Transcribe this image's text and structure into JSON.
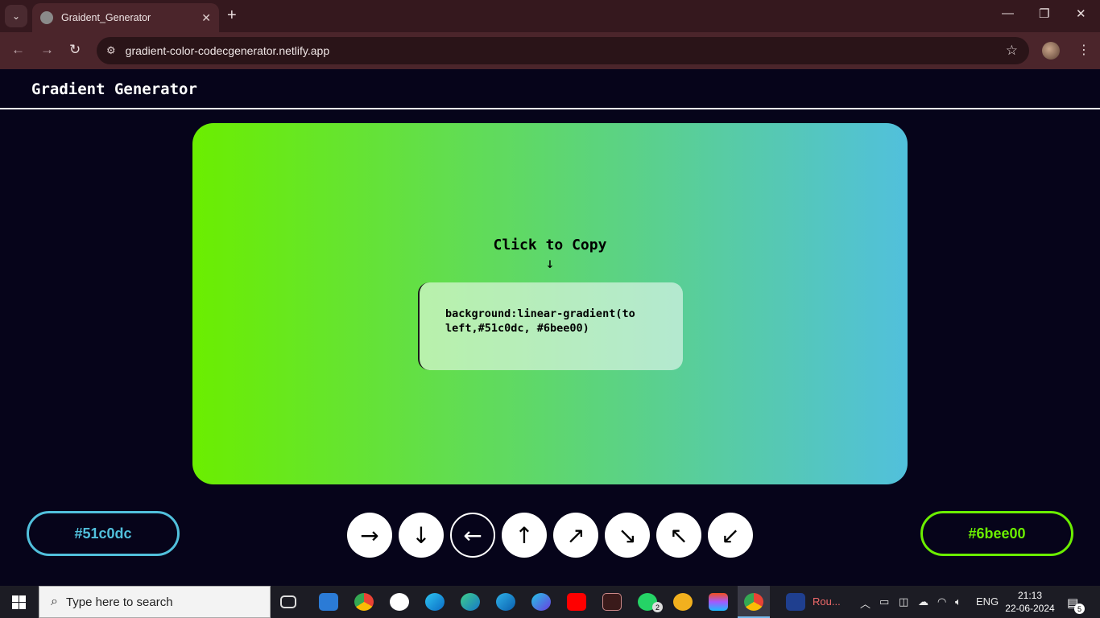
{
  "browser": {
    "tab_title": "Graident_Generator",
    "tab_close": "✕",
    "new_tab": "+",
    "url": "gradient-color-codecgenerator.netlify.app",
    "back": "←",
    "forward": "→",
    "reload": "↻",
    "site_info": "⚙",
    "bookmark": "☆",
    "menu": "⋮",
    "minimize": "—",
    "restore": "❐",
    "close": "✕",
    "tab_search": "⌄"
  },
  "page": {
    "title": "Gradient Generator",
    "copy_label": "Click to Copy",
    "copy_arrow": "↓",
    "code": "background:linear-gradient(to left,#51c0dc, #6bee00)",
    "color_left": "#51c0dc",
    "color_right": "#6bee00",
    "directions": [
      {
        "glyph": "→",
        "name": "to right"
      },
      {
        "glyph": "↓",
        "name": "to bottom"
      },
      {
        "glyph": "←",
        "name": "to left",
        "active": true
      },
      {
        "glyph": "↑",
        "name": "to top"
      },
      {
        "glyph": "↗",
        "name": "to top right"
      },
      {
        "glyph": "↘",
        "name": "to bottom right"
      },
      {
        "glyph": "↖",
        "name": "to top left"
      },
      {
        "glyph": "↙",
        "name": "to bottom left"
      }
    ]
  },
  "taskbar": {
    "search_placeholder": "Type here to search",
    "app_label": "Rou...",
    "whatsapp_badge": "2",
    "language": "ENG",
    "time": "21:13",
    "date": "22-06-2024",
    "notifications": "5"
  },
  "colors": {
    "accent_left": "#51c0dc",
    "accent_right": "#6bee00"
  }
}
